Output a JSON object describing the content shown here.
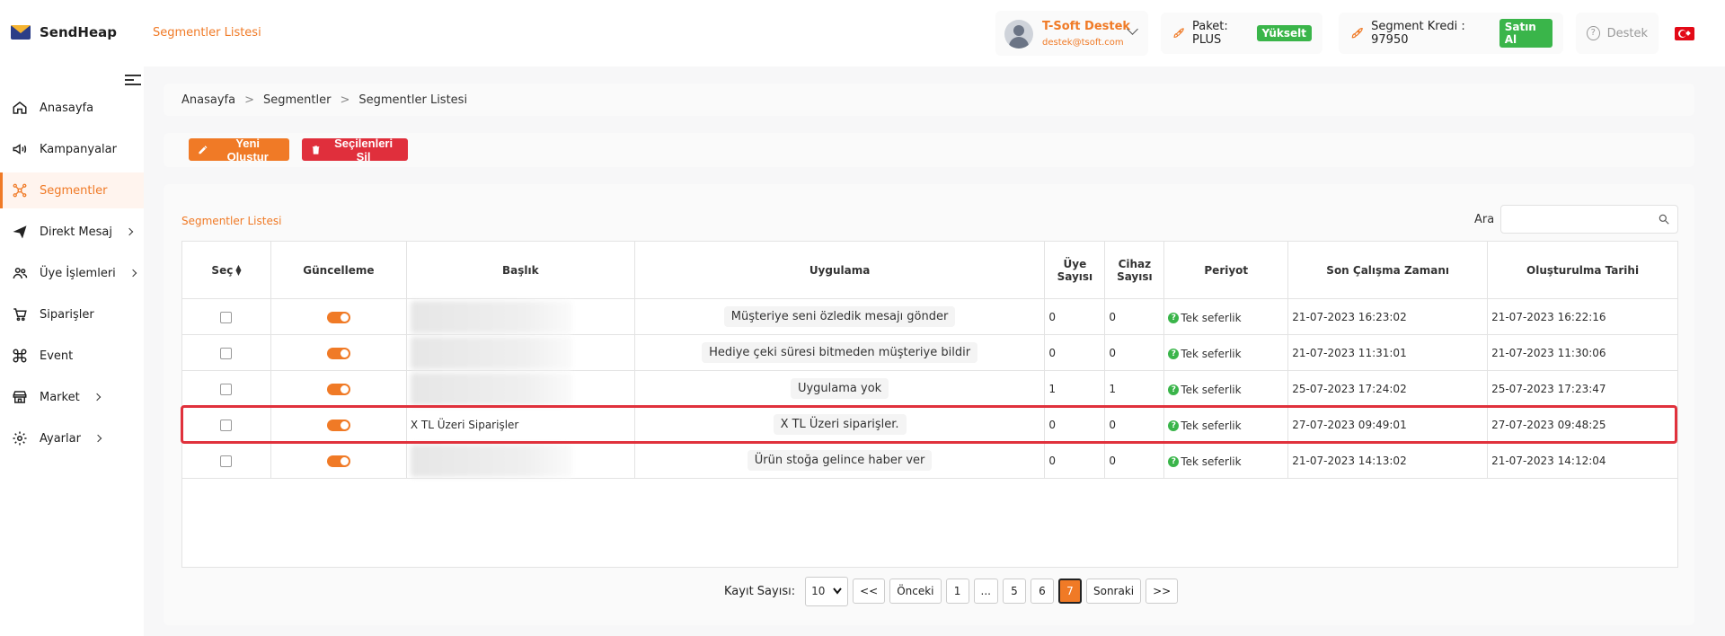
{
  "app": {
    "name": "SendHeap",
    "page_title": "Segmentler Listesi"
  },
  "header": {
    "user_name": "T-Soft Destek",
    "user_email": "destek@tsoft.com",
    "package_label": "Paket: PLUS",
    "upgrade_label": "Yükselt",
    "credit_label": "Segment Kredi : 97950",
    "buy_label": "Satın Al",
    "support_label": "Destek"
  },
  "sidebar": {
    "items": [
      {
        "label": "Anasayfa",
        "icon": "home-icon"
      },
      {
        "label": "Kampanyalar",
        "icon": "megaphone-icon"
      },
      {
        "label": "Segmentler",
        "icon": "segment-icon",
        "active": true
      },
      {
        "label": "Direkt Mesaj",
        "icon": "send-icon",
        "arrow": true
      },
      {
        "label": "Üye İşlemleri",
        "icon": "users-icon",
        "arrow": true
      },
      {
        "label": "Siparişler",
        "icon": "cart-icon"
      },
      {
        "label": "Event",
        "icon": "command-icon"
      },
      {
        "label": "Market",
        "icon": "store-icon",
        "arrow": true
      },
      {
        "label": "Ayarlar",
        "icon": "gear-icon",
        "arrow": true
      }
    ]
  },
  "breadcrumb": {
    "home": "Anasayfa",
    "sep": ">",
    "section": "Segmentler",
    "current": "Segmentler Listesi"
  },
  "toolbar": {
    "create_label": "Yeni Oluştur",
    "delete_label": "Seçilenleri Sil"
  },
  "list": {
    "title": "Segmentler Listesi",
    "search_label": "Ara",
    "columns": [
      "Seç",
      "Güncelleme",
      "Başlık",
      "Uygulama",
      "Üye Sayısı",
      "Cihaz Sayısı",
      "Periyot",
      "Son Çalışma Zamanı",
      "Oluşturulma Tarihi"
    ],
    "rows": [
      {
        "title": "",
        "app": "Müşteriye seni özledik mesajı gönder",
        "members": "0",
        "devices": "0",
        "period": "Tek seferlik",
        "last_run": "21-07-2023 16:23:02",
        "created": "21-07-2023 16:22:16"
      },
      {
        "title": "",
        "app": "Hediye çeki süresi bitmeden müşteriye bildir",
        "members": "0",
        "devices": "0",
        "period": "Tek seferlik",
        "last_run": "21-07-2023 11:31:01",
        "created": "21-07-2023 11:30:06"
      },
      {
        "title": "",
        "app": "Uygulama yok",
        "members": "1",
        "devices": "1",
        "period": "Tek seferlik",
        "last_run": "25-07-2023 17:24:02",
        "created": "25-07-2023 17:23:47"
      },
      {
        "title": "X TL Üzeri Siparişler",
        "app": "X TL Üzeri siparişler.",
        "members": "0",
        "devices": "0",
        "period": "Tek seferlik",
        "last_run": "27-07-2023 09:49:01",
        "created": "27-07-2023 09:48:25"
      },
      {
        "title": "",
        "app": "Ürün stoğa gelince haber ver",
        "members": "0",
        "devices": "0",
        "period": "Tek seferlik",
        "last_run": "21-07-2023 14:13:02",
        "created": "21-07-2023 14:12:04"
      }
    ]
  },
  "pagination": {
    "label": "Kayıt Sayısı:",
    "page_size": "10",
    "first": "<<",
    "prev": "Önceki",
    "pages": [
      "1",
      "...",
      "5",
      "6",
      "7"
    ],
    "current": "7",
    "next": "Sonraki",
    "last": ">>"
  },
  "colors": {
    "accent": "#f07a26",
    "danger": "#e02f3c",
    "success": "#3ab54a"
  }
}
